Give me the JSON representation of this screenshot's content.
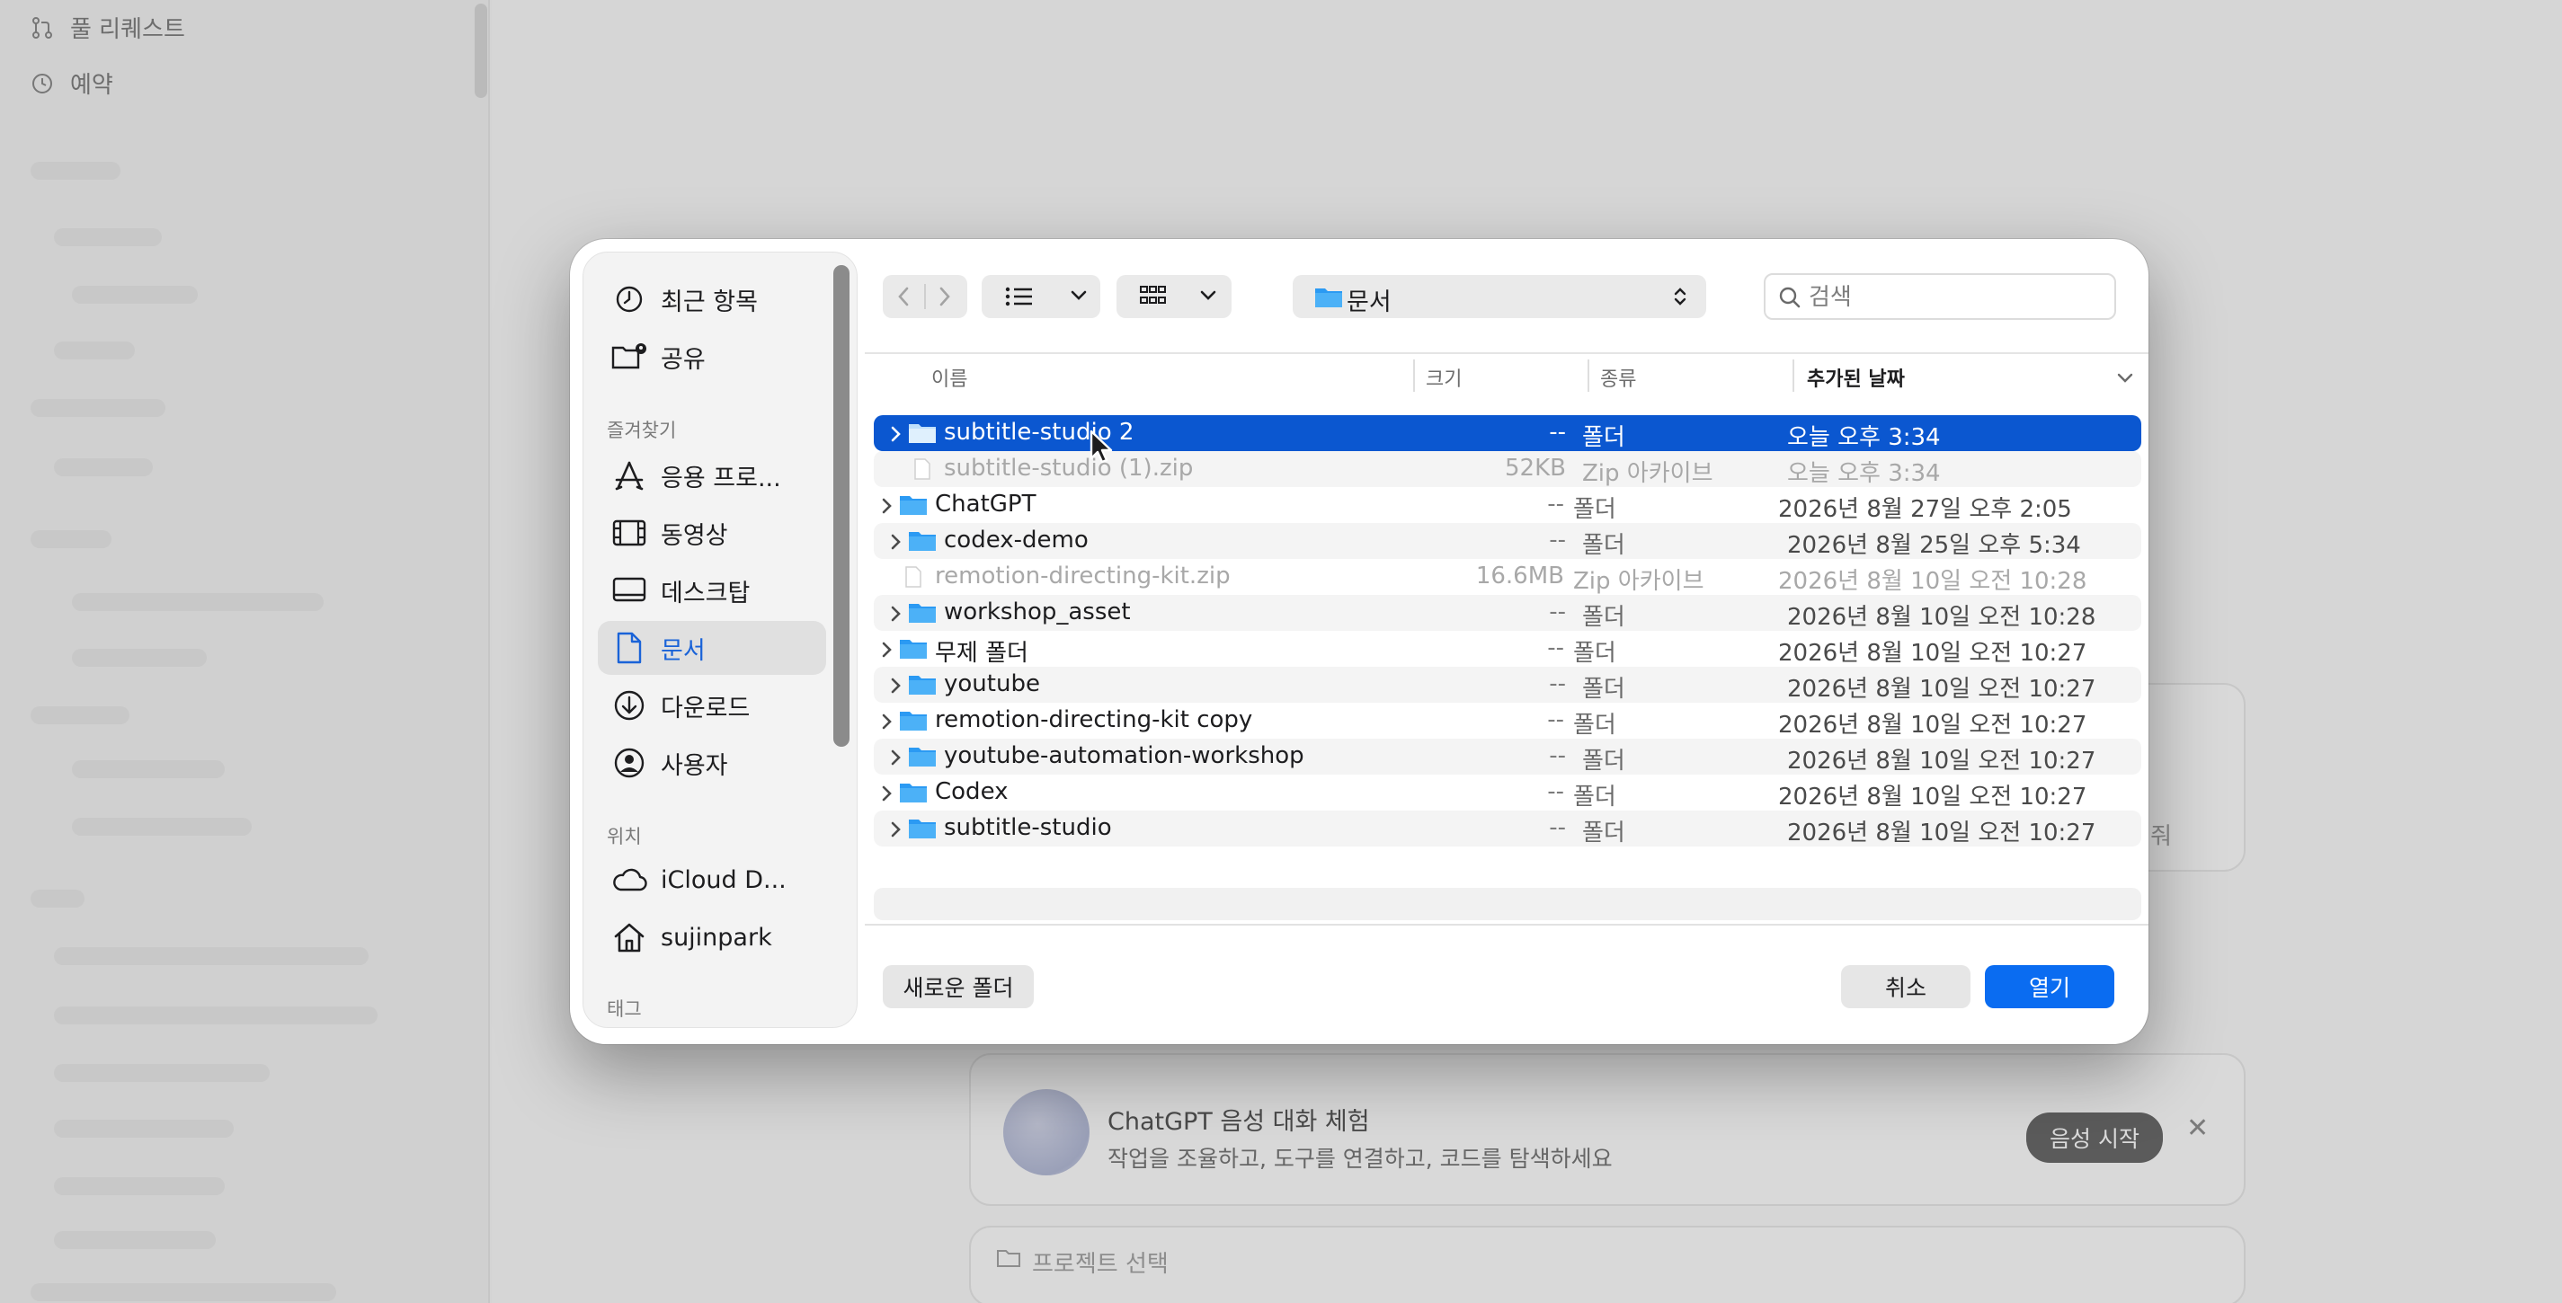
{
  "background": {
    "sidebar_items": [
      {
        "label": "풀 리퀘스트",
        "icon": "pull-request-icon"
      },
      {
        "label": "예약",
        "icon": "clock-icon"
      }
    ],
    "voice_card": {
      "title": "ChatGPT 음성 대화 체험",
      "subtitle": "작업을 조율하고, 도구를 연결하고, 코드를 탐색하세요",
      "start_button": "음성 시작",
      "close_icon": "close-icon"
    },
    "project_bar": {
      "label": "프로젝트 선택",
      "icon": "folder-icon"
    },
    "card_trailing_text": "줘"
  },
  "dialog": {
    "sidebar": {
      "items": [
        {
          "label": "최근 항목",
          "icon": "clock-icon"
        },
        {
          "label": "공유",
          "icon": "shared-folder-icon"
        }
      ],
      "favorites_header": "즐겨찾기",
      "favorites": [
        {
          "label": "응용 프로...",
          "icon": "applications-icon"
        },
        {
          "label": "동영상",
          "icon": "film-icon"
        },
        {
          "label": "데스크탑",
          "icon": "desktop-icon"
        },
        {
          "label": "문서",
          "icon": "document-icon",
          "active": true
        },
        {
          "label": "다운로드",
          "icon": "download-icon"
        },
        {
          "label": "사용자",
          "icon": "user-icon"
        }
      ],
      "locations_header": "위치",
      "locations": [
        {
          "label": "iCloud D...",
          "icon": "cloud-icon"
        },
        {
          "label": "sujinpark",
          "icon": "home-icon"
        }
      ],
      "tags_header": "태그"
    },
    "toolbar": {
      "back_icon": "chevron-left-icon",
      "forward_icon": "chevron-right-icon",
      "list_view_icon": "list-icon",
      "grid_view_icon": "grid-icon",
      "path": "문서",
      "search_placeholder": "검색"
    },
    "columns": {
      "name": "이름",
      "size": "크기",
      "kind": "종류",
      "date": "추가된 날짜"
    },
    "files": [
      {
        "name": "subtitle-studio 2",
        "size": "--",
        "kind": "폴더",
        "date": "오늘 오후 3:34",
        "type": "folder",
        "selected": true
      },
      {
        "name": "subtitle-studio (1).zip",
        "size": "52KB",
        "kind": "Zip 아카이브",
        "date": "오늘 오후 3:34",
        "type": "file"
      },
      {
        "name": "ChatGPT",
        "size": "--",
        "kind": "폴더",
        "date": "2026년 8월 27일 오후 2:05",
        "type": "folder"
      },
      {
        "name": "codex-demo",
        "size": "--",
        "kind": "폴더",
        "date": "2026년 8월 25일 오후 5:34",
        "type": "folder"
      },
      {
        "name": "remotion-directing-kit.zip",
        "size": "16.6MB",
        "kind": "Zip 아카이브",
        "date": "2026년 8월 10일 오전 10:28",
        "type": "file"
      },
      {
        "name": "workshop_asset",
        "size": "--",
        "kind": "폴더",
        "date": "2026년 8월 10일 오전 10:28",
        "type": "folder"
      },
      {
        "name": "무제 폴더",
        "size": "--",
        "kind": "폴더",
        "date": "2026년 8월 10일 오전 10:27",
        "type": "folder"
      },
      {
        "name": "youtube",
        "size": "--",
        "kind": "폴더",
        "date": "2026년 8월 10일 오전 10:27",
        "type": "folder"
      },
      {
        "name": "remotion-directing-kit copy",
        "size": "--",
        "kind": "폴더",
        "date": "2026년 8월 10일 오전 10:27",
        "type": "folder"
      },
      {
        "name": "youtube-automation-workshop",
        "size": "--",
        "kind": "폴더",
        "date": "2026년 8월 10일 오전 10:27",
        "type": "folder"
      },
      {
        "name": "Codex",
        "size": "--",
        "kind": "폴더",
        "date": "2026년 8월 10일 오전 10:27",
        "type": "folder"
      },
      {
        "name": "subtitle-studio",
        "size": "--",
        "kind": "폴더",
        "date": "2026년 8월 10일 오전 10:27",
        "type": "folder"
      }
    ],
    "buttons": {
      "new_folder": "새로운 폴더",
      "cancel": "취소",
      "open": "열기"
    }
  },
  "colors": {
    "accent": "#0a6cf1",
    "selection": "#0b57d0",
    "folder": "#1e9bf0"
  }
}
